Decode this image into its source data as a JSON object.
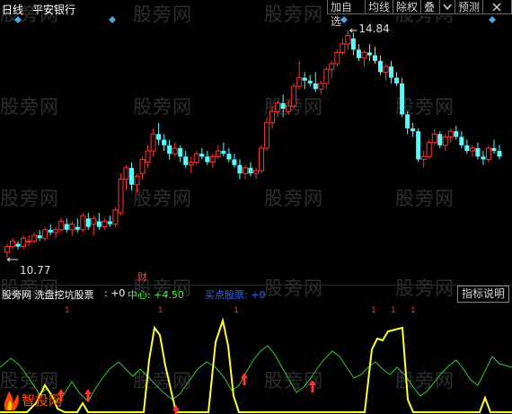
{
  "header": {
    "period": "日线",
    "stock_name": "平安银行"
  },
  "toolbar": {
    "buttons": [
      "加自选",
      "均线",
      "除权",
      "叠",
      "预测"
    ],
    "icon_close": "close-icon",
    "icon_dropdown": "chevron-down-icon"
  },
  "price_chart": {
    "high_label": "14.84",
    "low_label": "10.77",
    "event_marker": "财",
    "candle_up_color": "#ff3232",
    "candle_down_color": "#54ffff",
    "candles": [
      [
        10.9,
        11.05,
        10.8,
        11.0
      ],
      [
        11.0,
        11.15,
        10.95,
        11.1
      ],
      [
        11.05,
        11.1,
        10.95,
        11.0
      ],
      [
        11.0,
        11.2,
        10.95,
        11.15
      ],
      [
        11.1,
        11.2,
        11.0,
        11.1
      ],
      [
        11.1,
        11.25,
        11.05,
        11.2
      ],
      [
        11.2,
        11.3,
        11.1,
        11.15
      ],
      [
        11.15,
        11.35,
        11.1,
        11.3
      ],
      [
        11.3,
        11.4,
        11.2,
        11.25
      ],
      [
        11.25,
        11.35,
        11.15,
        11.3
      ],
      [
        11.3,
        11.5,
        11.25,
        11.45
      ],
      [
        11.4,
        11.5,
        11.25,
        11.3
      ],
      [
        11.3,
        11.45,
        11.2,
        11.4
      ],
      [
        11.35,
        11.5,
        11.25,
        11.3
      ],
      [
        11.3,
        11.6,
        11.25,
        11.55
      ],
      [
        11.5,
        11.6,
        11.3,
        11.35
      ],
      [
        11.4,
        11.55,
        11.2,
        11.5
      ],
      [
        11.45,
        11.6,
        11.3,
        11.35
      ],
      [
        11.35,
        11.5,
        11.3,
        11.45
      ],
      [
        11.45,
        11.55,
        11.35,
        11.4
      ],
      [
        11.4,
        11.7,
        11.35,
        11.65
      ],
      [
        11.6,
        12.3,
        11.55,
        12.2
      ],
      [
        12.2,
        12.45,
        12.0,
        12.4
      ],
      [
        12.4,
        12.5,
        12.0,
        12.1
      ],
      [
        12.1,
        12.3,
        11.95,
        12.25
      ],
      [
        12.3,
        12.6,
        12.2,
        12.55
      ],
      [
        12.5,
        12.8,
        12.4,
        12.7
      ],
      [
        12.7,
        13.1,
        12.6,
        13.0
      ],
      [
        13.0,
        13.2,
        12.8,
        12.9
      ],
      [
        12.9,
        13.0,
        12.7,
        12.8
      ],
      [
        12.8,
        12.9,
        12.55,
        12.65
      ],
      [
        12.65,
        12.85,
        12.6,
        12.75
      ],
      [
        12.75,
        12.8,
        12.5,
        12.6
      ],
      [
        12.6,
        12.7,
        12.4,
        12.45
      ],
      [
        12.45,
        12.6,
        12.3,
        12.5
      ],
      [
        12.5,
        12.7,
        12.45,
        12.65
      ],
      [
        12.65,
        12.75,
        12.55,
        12.6
      ],
      [
        12.6,
        12.7,
        12.45,
        12.5
      ],
      [
        12.5,
        12.65,
        12.4,
        12.6
      ],
      [
        12.6,
        12.8,
        12.55,
        12.7
      ],
      [
        12.7,
        12.85,
        12.6,
        12.65
      ],
      [
        12.65,
        12.75,
        12.5,
        12.55
      ],
      [
        12.55,
        12.65,
        12.4,
        12.45
      ],
      [
        12.45,
        12.55,
        12.2,
        12.3
      ],
      [
        12.3,
        12.45,
        12.2,
        12.4
      ],
      [
        12.4,
        12.5,
        12.25,
        12.3
      ],
      [
        12.3,
        12.4,
        12.2,
        12.35
      ],
      [
        12.35,
        12.8,
        12.3,
        12.75
      ],
      [
        12.75,
        13.3,
        12.7,
        13.2
      ],
      [
        13.2,
        13.5,
        13.1,
        13.4
      ],
      [
        13.4,
        13.6,
        13.3,
        13.55
      ],
      [
        13.55,
        13.7,
        13.3,
        13.45
      ],
      [
        13.4,
        13.6,
        13.35,
        13.5
      ],
      [
        13.5,
        13.9,
        13.45,
        13.85
      ],
      [
        13.85,
        14.3,
        13.8,
        14.0
      ],
      [
        14.0,
        14.1,
        13.8,
        13.95
      ],
      [
        13.95,
        14.05,
        13.85,
        13.9
      ],
      [
        13.9,
        14.1,
        13.75,
        13.8
      ],
      [
        13.8,
        13.95,
        13.7,
        13.9
      ],
      [
        13.9,
        14.2,
        13.8,
        14.15
      ],
      [
        14.15,
        14.3,
        14.0,
        14.25
      ],
      [
        14.25,
        14.5,
        14.2,
        14.45
      ],
      [
        14.45,
        14.7,
        14.4,
        14.6
      ],
      [
        14.6,
        14.84,
        14.5,
        14.75
      ],
      [
        14.7,
        14.8,
        14.4,
        14.5
      ],
      [
        14.5,
        14.6,
        14.3,
        14.35
      ],
      [
        14.35,
        14.5,
        14.2,
        14.45
      ],
      [
        14.45,
        14.6,
        14.3,
        14.4
      ],
      [
        14.4,
        14.55,
        14.25,
        14.3
      ],
      [
        14.3,
        14.4,
        14.05,
        14.1
      ],
      [
        14.1,
        14.25,
        13.95,
        14.2
      ],
      [
        14.2,
        14.3,
        13.9,
        14.0
      ],
      [
        14.0,
        14.1,
        13.85,
        13.9
      ],
      [
        13.9,
        14.0,
        13.3,
        13.35
      ],
      [
        13.35,
        13.4,
        13.0,
        13.1
      ],
      [
        13.1,
        13.2,
        12.95,
        13.05
      ],
      [
        13.05,
        13.1,
        12.5,
        12.55
      ],
      [
        12.55,
        12.7,
        12.4,
        12.6
      ],
      [
        12.6,
        12.9,
        12.55,
        12.85
      ],
      [
        12.85,
        13.1,
        12.8,
        13.0
      ],
      [
        13.0,
        13.05,
        12.75,
        12.8
      ],
      [
        12.8,
        13.0,
        12.7,
        12.95
      ],
      [
        12.95,
        13.1,
        12.85,
        13.05
      ],
      [
        13.05,
        13.15,
        12.9,
        12.95
      ],
      [
        12.95,
        13.05,
        12.75,
        12.8
      ],
      [
        12.8,
        12.9,
        12.65,
        12.7
      ],
      [
        12.7,
        12.8,
        12.6,
        12.75
      ],
      [
        12.75,
        12.85,
        12.55,
        12.6
      ],
      [
        12.6,
        12.7,
        12.45,
        12.55
      ],
      [
        12.55,
        12.8,
        12.5,
        12.75
      ],
      [
        12.75,
        12.9,
        12.65,
        12.7
      ],
      [
        12.7,
        12.8,
        12.55,
        12.6
      ]
    ]
  },
  "indicator": {
    "name": "股旁网 洗盘挖坑股票",
    "value_main": ": +0",
    "label_center": "中心: +4.50",
    "label_buy": "买点股票: +0",
    "help_button": "指标说明",
    "top_markers": [
      "1",
      "1",
      "1",
      "1",
      "1",
      "1"
    ],
    "yellow_color": "#ffff33",
    "green_color": "#33cc33",
    "arrow_color": "#ff3333"
  },
  "watermark": "股旁网",
  "logo_text": "智投网"
}
